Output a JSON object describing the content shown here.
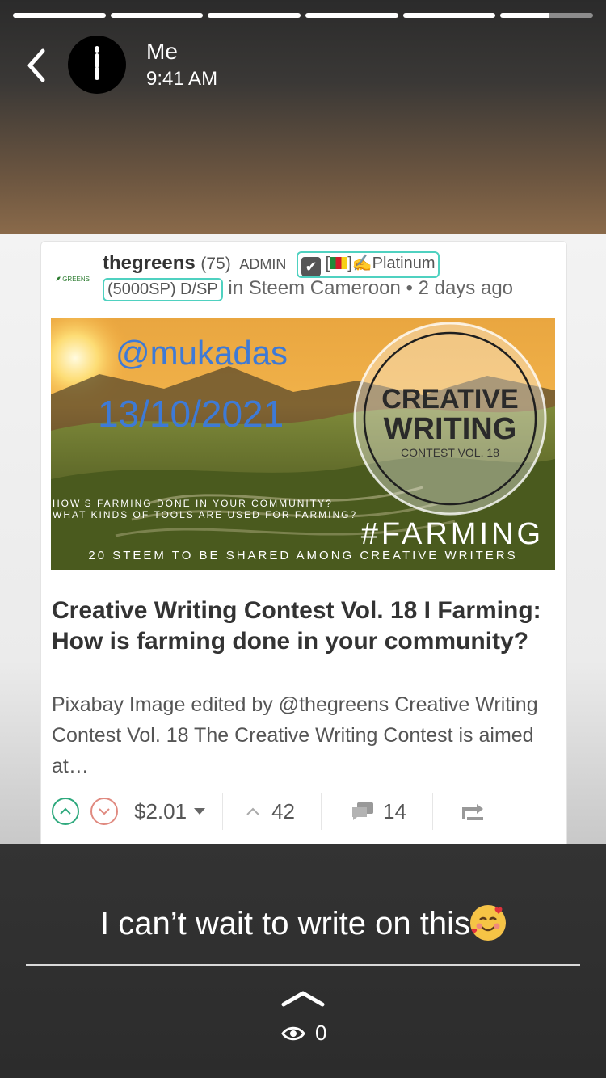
{
  "story": {
    "progress": {
      "segments": 6,
      "completed": 5,
      "current_fraction": 0.52
    },
    "user": {
      "name": "Me",
      "time": "9:41 AM"
    },
    "caption": "I can’t wait to write on this",
    "caption_emoji": "smiling-face-with-hearts",
    "views": "0"
  },
  "post": {
    "logo_text": "GREENS",
    "author": "thegreens",
    "reputation": "(75)",
    "role": "ADMIN",
    "badge": "[",
    "badge_flag_close": "]",
    "badge_level": "Platinum",
    "badge_sp": "(5000SP) D/SP",
    "community": "in Steem Cameroon",
    "age": "2 days ago",
    "bullet": "•",
    "image": {
      "handle": "@mukadas",
      "date": "13/10/2021",
      "creative": "CREATIVE",
      "writing": "WRITING",
      "contest": "CONTEST VOL. 18",
      "q1": "HOW'S FARMING DONE IN YOUR COMMUNITY?",
      "q2": "WHAT KINDS OF TOOLS ARE USED FOR FARMING?",
      "hashtag": "#FARMING",
      "prize": "20 STEEM TO BE SHARED AMONG CREATIVE WRITERS"
    },
    "title": "Creative Writing Contest Vol. 18 I Farming: How is farming done in your community?",
    "excerpt": "Pixabay Image edited by @thegreens Creative Writing Contest Vol. 18 The Creative Writing Contest is aimed at…",
    "payout": "$2.01",
    "votes": "42",
    "comments": "14"
  },
  "colors": {
    "accent_teal": "#4fd1c0",
    "upvote": "#2ea97d",
    "downvote": "#e08a80"
  }
}
